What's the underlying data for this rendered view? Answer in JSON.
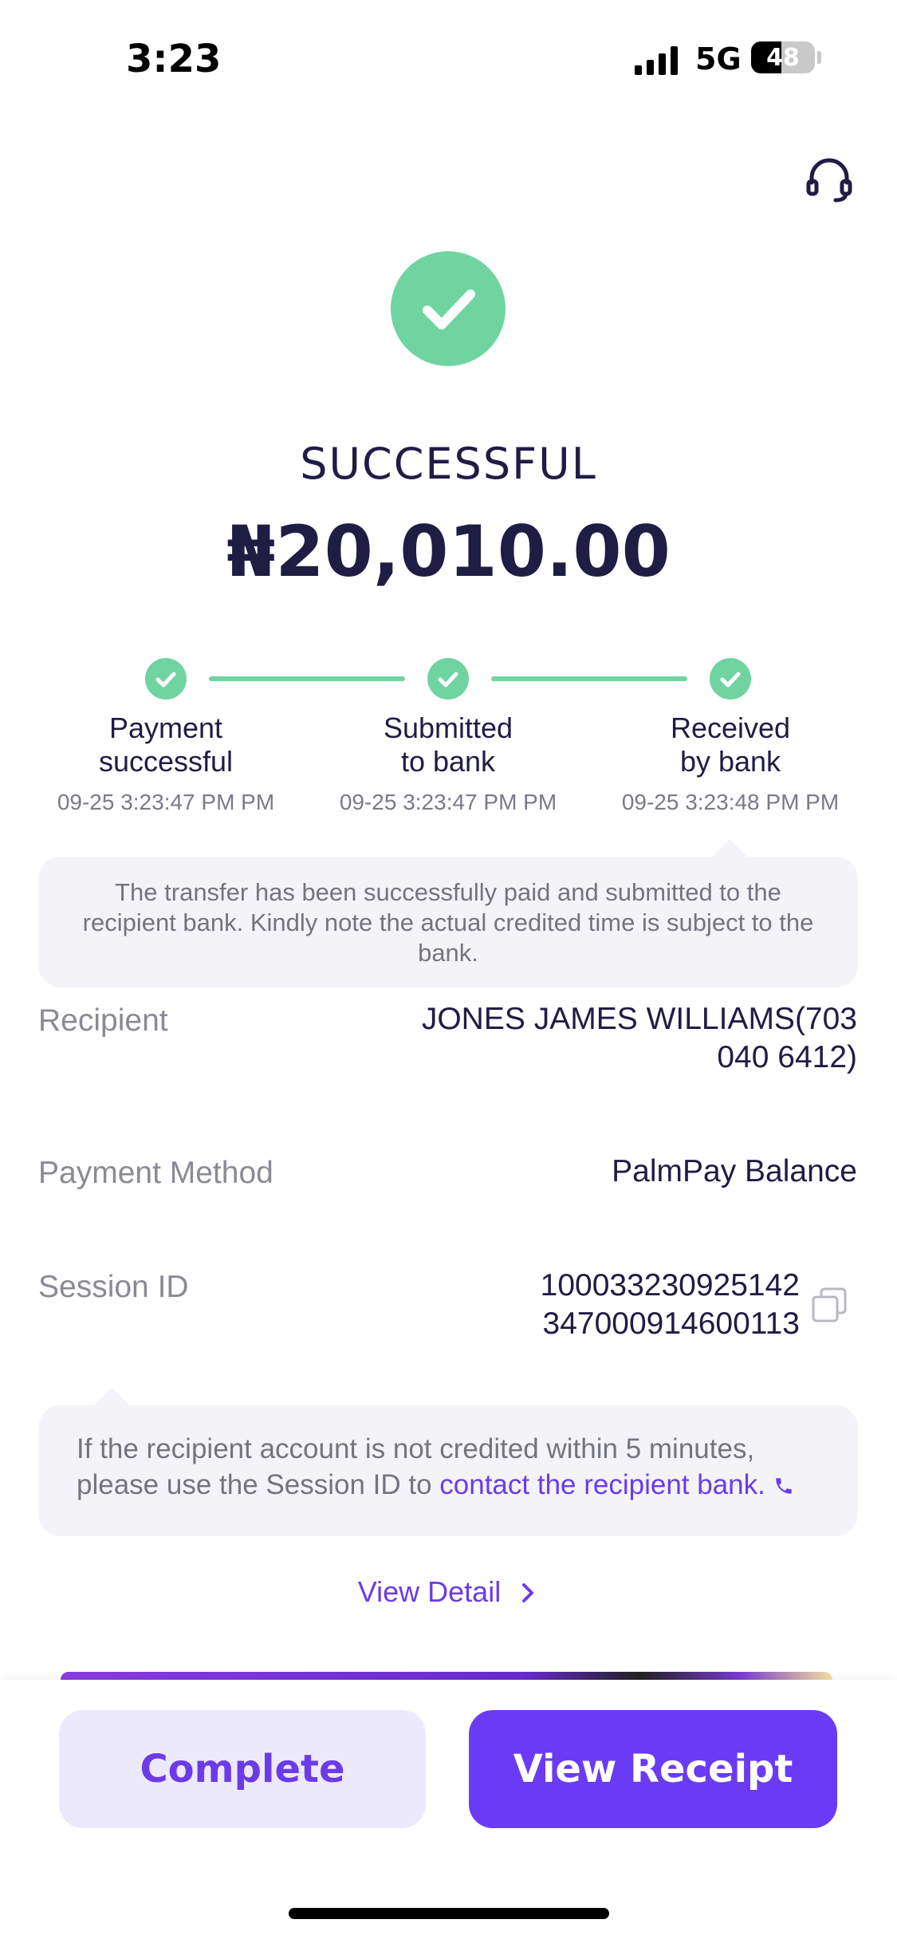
{
  "status_bar": {
    "time": "3:23",
    "network": "5G",
    "battery": "48",
    "battery_level": 0.48
  },
  "header": {
    "support_icon": "headset-icon"
  },
  "result": {
    "status": "SUCCESSFUL",
    "amount": "₦20,010.00",
    "icon": "check-circle-icon",
    "accent": "#6fd4a0"
  },
  "progress": [
    {
      "label": "Payment\nsuccessful",
      "time": "09-25 3:23:47 PM PM"
    },
    {
      "label": "Submitted\nto bank",
      "time": "09-25 3:23:47 PM PM"
    },
    {
      "label": "Received\nby bank",
      "time": "09-25 3:23:48 PM PM"
    }
  ],
  "notice": "The transfer has been successfully paid and submitted to the recipient bank. Kindly note the actual credited time is subject to the bank.",
  "details": {
    "recipient_label": "Recipient",
    "recipient_value": "JONES JAMES WILLIAMS(703 040 6412)",
    "method_label": "Payment Method",
    "method_value": "PalmPay Balance",
    "session_label": "Session ID",
    "session_value_line1": "100033230925142",
    "session_value_line2": "347000914600113"
  },
  "session_notice": {
    "text": "If the recipient account is not credited within 5 minutes, please use the Session ID to ",
    "link": "contact the recipient bank."
  },
  "view_detail": "View Detail",
  "buttons": {
    "complete": "Complete",
    "view_receipt": "View Receipt"
  },
  "colors": {
    "primary": "#6a3bf5",
    "success": "#6fd4a0",
    "text": "#1f1d44"
  }
}
